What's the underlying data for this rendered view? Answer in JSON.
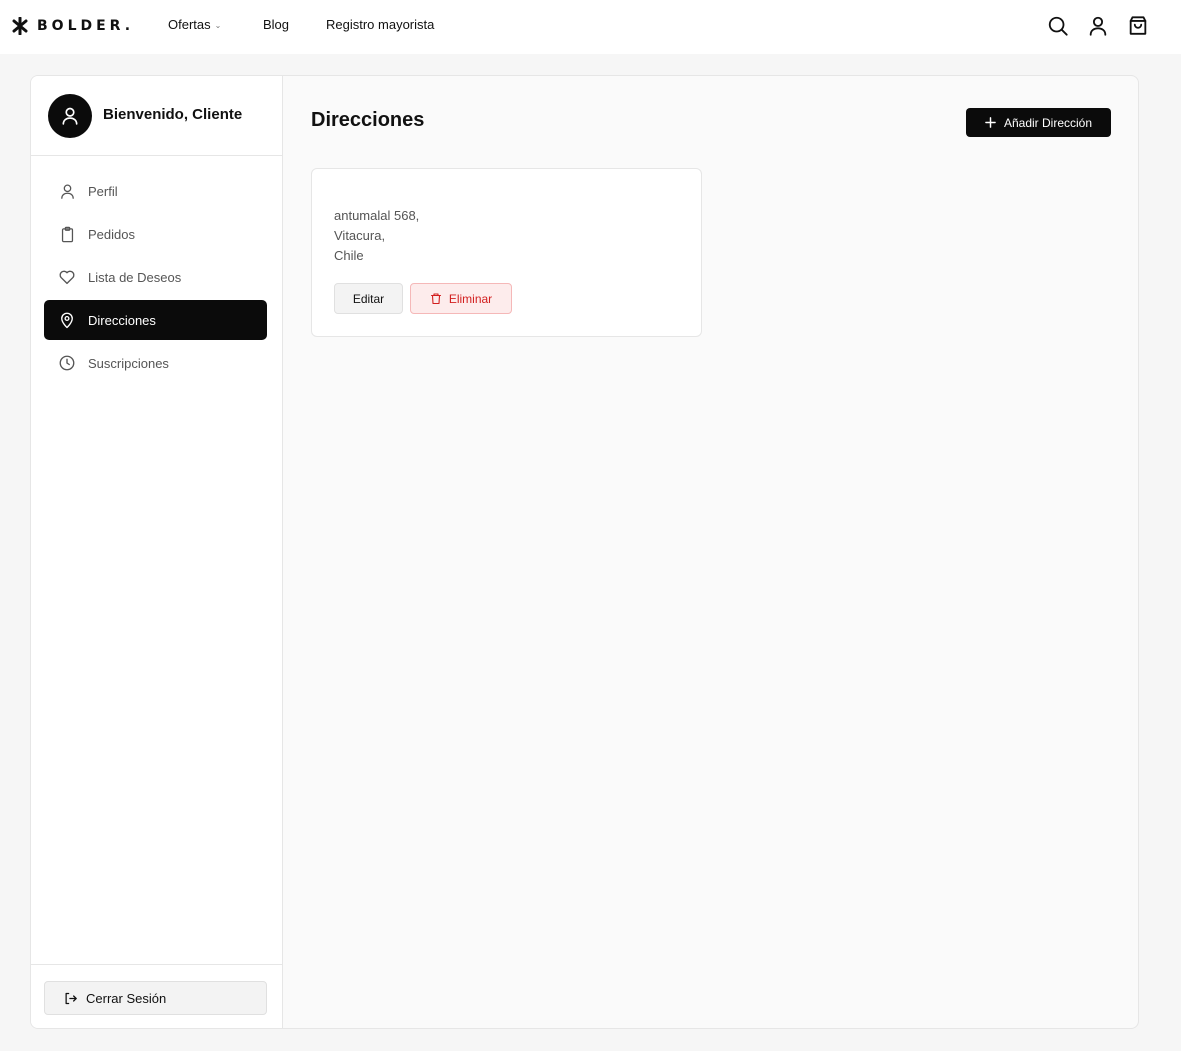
{
  "header": {
    "brand": "BOLDER.",
    "nav": [
      {
        "label": "Ofertas",
        "has_dropdown": true
      },
      {
        "label": "Blog"
      },
      {
        "label": "Registro mayorista"
      }
    ],
    "icons": [
      "search-icon",
      "user-icon",
      "bag-icon"
    ]
  },
  "sidebar": {
    "welcome": "Bienvenido, Cliente",
    "items": [
      {
        "label": "Perfil",
        "icon": "user-icon",
        "active": false
      },
      {
        "label": "Pedidos",
        "icon": "clipboard-icon",
        "active": false
      },
      {
        "label": "Lista de Deseos",
        "icon": "heart-icon",
        "active": false
      },
      {
        "label": "Direcciones",
        "icon": "location-pin-icon",
        "active": true
      },
      {
        "label": "Suscripciones",
        "icon": "clock-icon",
        "active": false
      }
    ],
    "logout": "Cerrar Sesión"
  },
  "main": {
    "title": "Direcciones",
    "add_button": "Añadir Dirección",
    "addresses": [
      {
        "lines": [
          "antumalal 568,",
          "Vitacura,",
          "Chile"
        ],
        "edit_label": "Editar",
        "delete_label": "Eliminar"
      }
    ]
  },
  "colors": {
    "accent": "#0b0b0b",
    "danger": "#d21f1f",
    "danger_bg": "#fdecec",
    "page_bg": "#f6f6f6"
  }
}
